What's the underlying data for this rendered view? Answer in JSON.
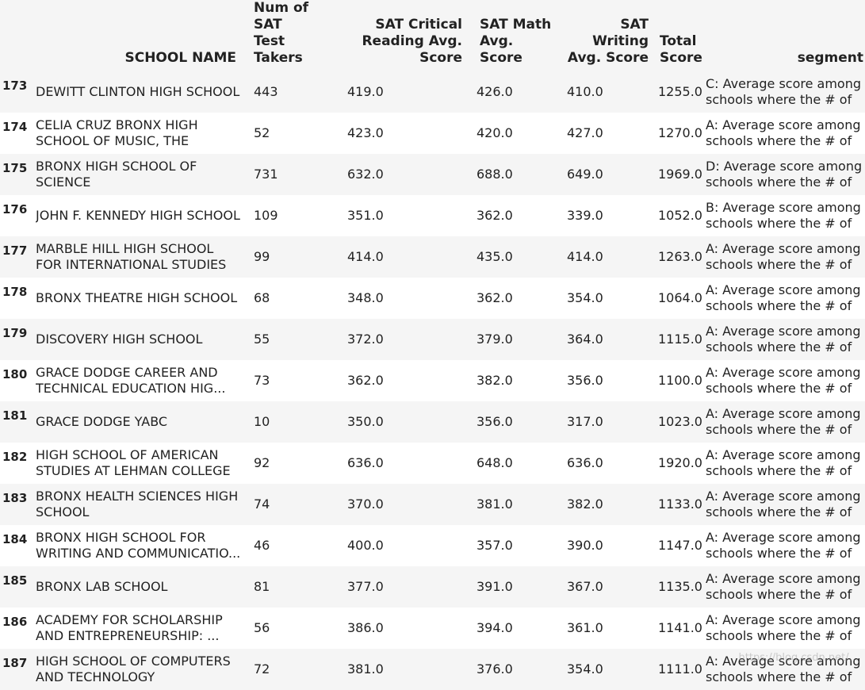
{
  "table": {
    "columns": [
      "SCHOOL NAME",
      "Num of SAT Test Takers",
      "SAT Critical Reading Avg. Score",
      "SAT Math Avg. Score",
      "SAT Writing Avg. Score",
      "Total Score",
      "segment"
    ],
    "header_lines": {
      "school_name": [
        "SCHOOL NAME"
      ],
      "takers": [
        "Num of SAT",
        "Test Takers"
      ],
      "reading": [
        "SAT Critical",
        "Reading Avg.",
        "Score"
      ],
      "math": [
        "SAT Math",
        "Avg. Score"
      ],
      "writing": [
        "SAT",
        "Writing",
        "Avg. Score"
      ],
      "total": [
        "Total",
        "Score"
      ],
      "segment": [
        "segment"
      ]
    },
    "rows": [
      {
        "index": "173",
        "school_name": "DEWITT CLINTON HIGH SCHOOL",
        "takers": "443",
        "reading": "419.0",
        "math": "426.0",
        "writing": "410.0",
        "total": "1255.0",
        "segment": "C: Average score among schools where the # of ..."
      },
      {
        "index": "174",
        "school_name": "CELIA CRUZ BRONX HIGH SCHOOL OF MUSIC, THE",
        "takers": "52",
        "reading": "423.0",
        "math": "420.0",
        "writing": "427.0",
        "total": "1270.0",
        "segment": "A: Average score among schools where the # of ..."
      },
      {
        "index": "175",
        "school_name": "BRONX HIGH SCHOOL OF SCIENCE",
        "takers": "731",
        "reading": "632.0",
        "math": "688.0",
        "writing": "649.0",
        "total": "1969.0",
        "segment": "D: Average score among schools where the # of ..."
      },
      {
        "index": "176",
        "school_name": "JOHN F. KENNEDY HIGH SCHOOL",
        "takers": "109",
        "reading": "351.0",
        "math": "362.0",
        "writing": "339.0",
        "total": "1052.0",
        "segment": "B: Average score among schools where the # of ..."
      },
      {
        "index": "177",
        "school_name": "MARBLE HILL HIGH SCHOOL FOR INTERNATIONAL STUDIES",
        "takers": "99",
        "reading": "414.0",
        "math": "435.0",
        "writing": "414.0",
        "total": "1263.0",
        "segment": "A: Average score among schools where the # of ..."
      },
      {
        "index": "178",
        "school_name": "BRONX THEATRE HIGH SCHOOL",
        "takers": "68",
        "reading": "348.0",
        "math": "362.0",
        "writing": "354.0",
        "total": "1064.0",
        "segment": "A: Average score among schools where the # of ..."
      },
      {
        "index": "179",
        "school_name": "DISCOVERY HIGH SCHOOL",
        "takers": "55",
        "reading": "372.0",
        "math": "379.0",
        "writing": "364.0",
        "total": "1115.0",
        "segment": "A: Average score among schools where the # of ..."
      },
      {
        "index": "180",
        "school_name": "GRACE DODGE CAREER AND TECHNICAL EDUCATION HIG...",
        "takers": "73",
        "reading": "362.0",
        "math": "382.0",
        "writing": "356.0",
        "total": "1100.0",
        "segment": "A: Average score among schools where the # of ..."
      },
      {
        "index": "181",
        "school_name": "GRACE DODGE YABC",
        "takers": "10",
        "reading": "350.0",
        "math": "356.0",
        "writing": "317.0",
        "total": "1023.0",
        "segment": "A: Average score among schools where the # of ..."
      },
      {
        "index": "182",
        "school_name": "HIGH SCHOOL OF AMERICAN STUDIES AT LEHMAN COLLEGE",
        "takers": "92",
        "reading": "636.0",
        "math": "648.0",
        "writing": "636.0",
        "total": "1920.0",
        "segment": "A: Average score among schools where the # of ..."
      },
      {
        "index": "183",
        "school_name": "BRONX HEALTH SCIENCES HIGH SCHOOL",
        "takers": "74",
        "reading": "370.0",
        "math": "381.0",
        "writing": "382.0",
        "total": "1133.0",
        "segment": "A: Average score among schools where the # of ..."
      },
      {
        "index": "184",
        "school_name": "BRONX HIGH SCHOOL FOR WRITING AND COMMUNICATIO...",
        "takers": "46",
        "reading": "400.0",
        "math": "357.0",
        "writing": "390.0",
        "total": "1147.0",
        "segment": "A: Average score among schools where the # of ..."
      },
      {
        "index": "185",
        "school_name": "BRONX LAB SCHOOL",
        "takers": "81",
        "reading": "377.0",
        "math": "391.0",
        "writing": "367.0",
        "total": "1135.0",
        "segment": "A: Average score among schools where the # of ..."
      },
      {
        "index": "186",
        "school_name": "ACADEMY FOR SCHOLARSHIP AND ENTREPRENEURSHIP: ...",
        "takers": "56",
        "reading": "386.0",
        "math": "394.0",
        "writing": "361.0",
        "total": "1141.0",
        "segment": "A: Average score among schools where the # of ..."
      },
      {
        "index": "187",
        "school_name": "HIGH SCHOOL OF COMPUTERS AND TECHNOLOGY",
        "takers": "72",
        "reading": "381.0",
        "math": "376.0",
        "writing": "354.0",
        "total": "1111.0",
        "segment": "A: Average score among schools where the # of ..."
      }
    ]
  },
  "colors": {
    "row_stripe": "#f5f5f5",
    "row_plain": "#ffffff",
    "text": "#222222"
  }
}
